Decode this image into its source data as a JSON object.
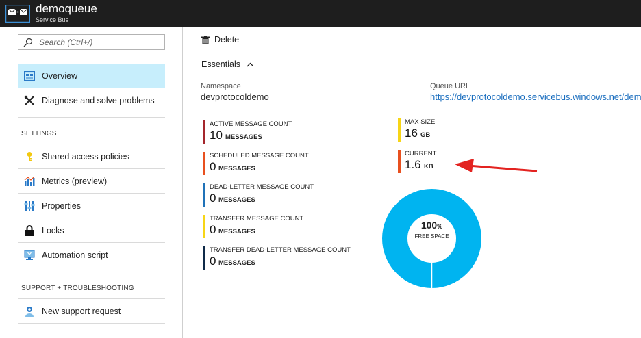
{
  "header": {
    "title": "demoqueue",
    "subtitle": "Service Bus",
    "icon": "service-bus-queue-icon"
  },
  "sidebar": {
    "search_placeholder": "Search (Ctrl+/)",
    "items_top": [
      {
        "label": "Overview",
        "icon": "overview-icon",
        "active": true
      },
      {
        "label": "Diagnose and solve problems",
        "icon": "tools-icon",
        "active": false
      }
    ],
    "settings_label": "SETTINGS",
    "settings_items": [
      {
        "label": "Shared access policies",
        "icon": "key-icon"
      },
      {
        "label": "Metrics (preview)",
        "icon": "metrics-icon"
      },
      {
        "label": "Properties",
        "icon": "properties-icon"
      },
      {
        "label": "Locks",
        "icon": "lock-icon"
      },
      {
        "label": "Automation script",
        "icon": "automation-icon"
      }
    ],
    "support_label": "SUPPORT + TROUBLESHOOTING",
    "support_items": [
      {
        "label": "New support request",
        "icon": "support-person-icon"
      }
    ]
  },
  "toolbar": {
    "delete_label": "Delete"
  },
  "essentials": {
    "label": "Essentials",
    "namespace_label": "Namespace",
    "namespace_value": "devprotocoldemo",
    "url_label": "Queue URL",
    "url_value": "https://devprotocoldemo.servicebus.windows.net/demoqueue"
  },
  "metrics": [
    {
      "label": "ACTIVE MESSAGE COUNT",
      "value": "10",
      "unit": "MESSAGES",
      "color": "#a4262c"
    },
    {
      "label": "SCHEDULED MESSAGE COUNT",
      "value": "0",
      "unit": "MESSAGES",
      "color": "#e8501f"
    },
    {
      "label": "DEAD-LETTER MESSAGE COUNT",
      "value": "0",
      "unit": "MESSAGES",
      "color": "#2072b8"
    },
    {
      "label": "TRANSFER MESSAGE COUNT",
      "value": "0",
      "unit": "MESSAGES",
      "color": "#f7d516"
    },
    {
      "label": "TRANSFER DEAD-LETTER MESSAGE COUNT",
      "value": "0",
      "unit": "MESSAGES",
      "color": "#0f2a48"
    }
  ],
  "size": {
    "max_label": "MAX SIZE",
    "max_value": "16",
    "max_unit": "GB",
    "max_color": "#f7d516",
    "current_label": "CURRENT",
    "current_value": "1.6",
    "current_unit": "KB",
    "current_color": "#e8501f"
  },
  "donut": {
    "percent": "100",
    "percent_sign": "%",
    "caption": "FREE SPACE",
    "free_fraction": 1.0,
    "color": "#00b4f0"
  },
  "annotation": {
    "arrow_color": "#e32320"
  }
}
